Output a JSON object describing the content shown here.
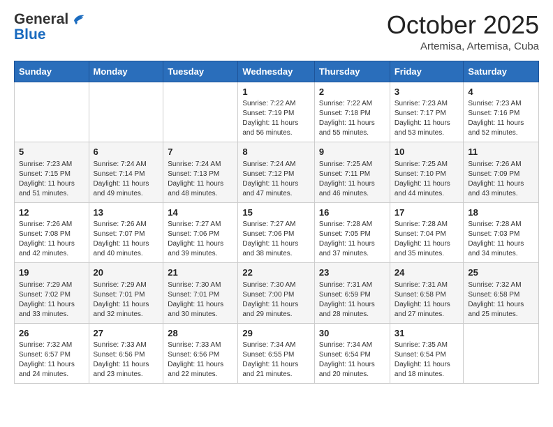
{
  "header": {
    "logo_line1": "General",
    "logo_line2": "Blue",
    "month": "October 2025",
    "location": "Artemisa, Artemisa, Cuba"
  },
  "weekdays": [
    "Sunday",
    "Monday",
    "Tuesday",
    "Wednesday",
    "Thursday",
    "Friday",
    "Saturday"
  ],
  "weeks": [
    [
      {
        "day": "",
        "info": ""
      },
      {
        "day": "",
        "info": ""
      },
      {
        "day": "",
        "info": ""
      },
      {
        "day": "1",
        "info": "Sunrise: 7:22 AM\nSunset: 7:19 PM\nDaylight: 11 hours and 56 minutes."
      },
      {
        "day": "2",
        "info": "Sunrise: 7:22 AM\nSunset: 7:18 PM\nDaylight: 11 hours and 55 minutes."
      },
      {
        "day": "3",
        "info": "Sunrise: 7:23 AM\nSunset: 7:17 PM\nDaylight: 11 hours and 53 minutes."
      },
      {
        "day": "4",
        "info": "Sunrise: 7:23 AM\nSunset: 7:16 PM\nDaylight: 11 hours and 52 minutes."
      }
    ],
    [
      {
        "day": "5",
        "info": "Sunrise: 7:23 AM\nSunset: 7:15 PM\nDaylight: 11 hours and 51 minutes."
      },
      {
        "day": "6",
        "info": "Sunrise: 7:24 AM\nSunset: 7:14 PM\nDaylight: 11 hours and 49 minutes."
      },
      {
        "day": "7",
        "info": "Sunrise: 7:24 AM\nSunset: 7:13 PM\nDaylight: 11 hours and 48 minutes."
      },
      {
        "day": "8",
        "info": "Sunrise: 7:24 AM\nSunset: 7:12 PM\nDaylight: 11 hours and 47 minutes."
      },
      {
        "day": "9",
        "info": "Sunrise: 7:25 AM\nSunset: 7:11 PM\nDaylight: 11 hours and 46 minutes."
      },
      {
        "day": "10",
        "info": "Sunrise: 7:25 AM\nSunset: 7:10 PM\nDaylight: 11 hours and 44 minutes."
      },
      {
        "day": "11",
        "info": "Sunrise: 7:26 AM\nSunset: 7:09 PM\nDaylight: 11 hours and 43 minutes."
      }
    ],
    [
      {
        "day": "12",
        "info": "Sunrise: 7:26 AM\nSunset: 7:08 PM\nDaylight: 11 hours and 42 minutes."
      },
      {
        "day": "13",
        "info": "Sunrise: 7:26 AM\nSunset: 7:07 PM\nDaylight: 11 hours and 40 minutes."
      },
      {
        "day": "14",
        "info": "Sunrise: 7:27 AM\nSunset: 7:06 PM\nDaylight: 11 hours and 39 minutes."
      },
      {
        "day": "15",
        "info": "Sunrise: 7:27 AM\nSunset: 7:06 PM\nDaylight: 11 hours and 38 minutes."
      },
      {
        "day": "16",
        "info": "Sunrise: 7:28 AM\nSunset: 7:05 PM\nDaylight: 11 hours and 37 minutes."
      },
      {
        "day": "17",
        "info": "Sunrise: 7:28 AM\nSunset: 7:04 PM\nDaylight: 11 hours and 35 minutes."
      },
      {
        "day": "18",
        "info": "Sunrise: 7:28 AM\nSunset: 7:03 PM\nDaylight: 11 hours and 34 minutes."
      }
    ],
    [
      {
        "day": "19",
        "info": "Sunrise: 7:29 AM\nSunset: 7:02 PM\nDaylight: 11 hours and 33 minutes."
      },
      {
        "day": "20",
        "info": "Sunrise: 7:29 AM\nSunset: 7:01 PM\nDaylight: 11 hours and 32 minutes."
      },
      {
        "day": "21",
        "info": "Sunrise: 7:30 AM\nSunset: 7:01 PM\nDaylight: 11 hours and 30 minutes."
      },
      {
        "day": "22",
        "info": "Sunrise: 7:30 AM\nSunset: 7:00 PM\nDaylight: 11 hours and 29 minutes."
      },
      {
        "day": "23",
        "info": "Sunrise: 7:31 AM\nSunset: 6:59 PM\nDaylight: 11 hours and 28 minutes."
      },
      {
        "day": "24",
        "info": "Sunrise: 7:31 AM\nSunset: 6:58 PM\nDaylight: 11 hours and 27 minutes."
      },
      {
        "day": "25",
        "info": "Sunrise: 7:32 AM\nSunset: 6:58 PM\nDaylight: 11 hours and 25 minutes."
      }
    ],
    [
      {
        "day": "26",
        "info": "Sunrise: 7:32 AM\nSunset: 6:57 PM\nDaylight: 11 hours and 24 minutes."
      },
      {
        "day": "27",
        "info": "Sunrise: 7:33 AM\nSunset: 6:56 PM\nDaylight: 11 hours and 23 minutes."
      },
      {
        "day": "28",
        "info": "Sunrise: 7:33 AM\nSunset: 6:56 PM\nDaylight: 11 hours and 22 minutes."
      },
      {
        "day": "29",
        "info": "Sunrise: 7:34 AM\nSunset: 6:55 PM\nDaylight: 11 hours and 21 minutes."
      },
      {
        "day": "30",
        "info": "Sunrise: 7:34 AM\nSunset: 6:54 PM\nDaylight: 11 hours and 20 minutes."
      },
      {
        "day": "31",
        "info": "Sunrise: 7:35 AM\nSunset: 6:54 PM\nDaylight: 11 hours and 18 minutes."
      },
      {
        "day": "",
        "info": ""
      }
    ]
  ]
}
